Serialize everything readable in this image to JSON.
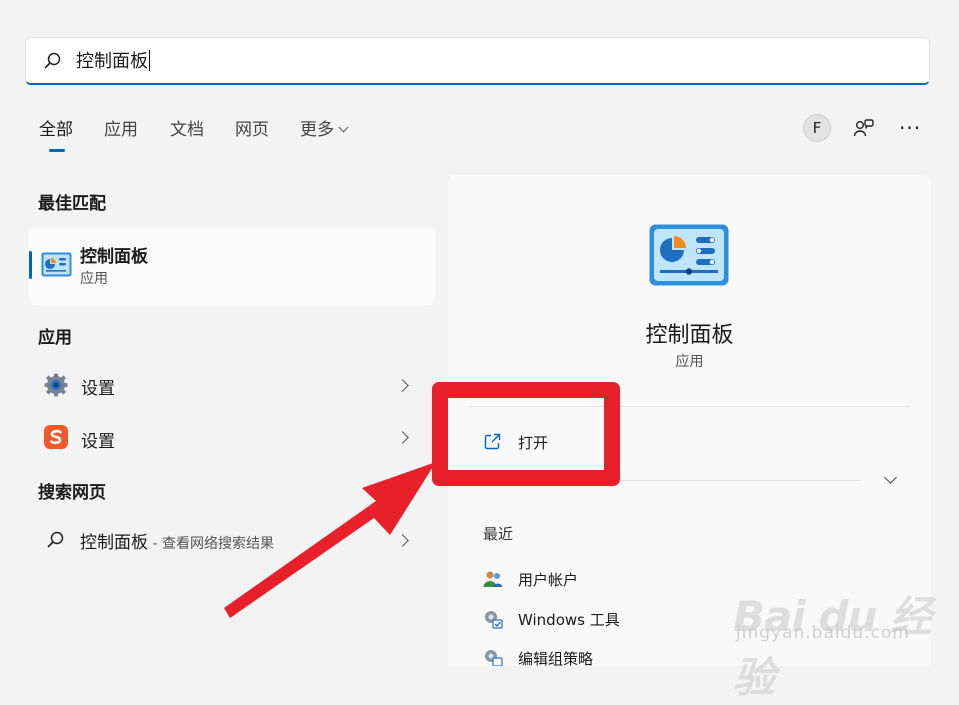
{
  "search": {
    "query": "控制面板"
  },
  "tabs": [
    {
      "label": "全部",
      "active": true
    },
    {
      "label": "应用"
    },
    {
      "label": "文档"
    },
    {
      "label": "网页"
    },
    {
      "label": "更多"
    }
  ],
  "toolbar": {
    "avatar_letter": "F",
    "more_label": "···"
  },
  "best_match": {
    "section_title": "最佳匹配",
    "name": "控制面板",
    "type": "应用"
  },
  "apps": {
    "section_title": "应用",
    "items": [
      {
        "label": "设置",
        "icon": "gear-icon"
      },
      {
        "label": "设置",
        "icon": "sogou-icon"
      }
    ]
  },
  "web": {
    "section_title": "搜索网页",
    "query": "控制面板",
    "suffix": " - 查看网络搜索结果"
  },
  "detail": {
    "title": "控制面板",
    "subtitle": "应用",
    "open_label": "打开",
    "recent_title": "最近",
    "recent": [
      {
        "label": "用户帐户",
        "icon": "users-icon"
      },
      {
        "label": "Windows 工具",
        "icon": "tools-icon"
      },
      {
        "label": "编辑组策略",
        "icon": "policy-icon"
      }
    ]
  },
  "colors": {
    "accent": "#0067c0",
    "annotation": "#e8202a"
  },
  "watermark": {
    "logo": "Bai du 经验",
    "url": "jingyan.baidu.com"
  }
}
